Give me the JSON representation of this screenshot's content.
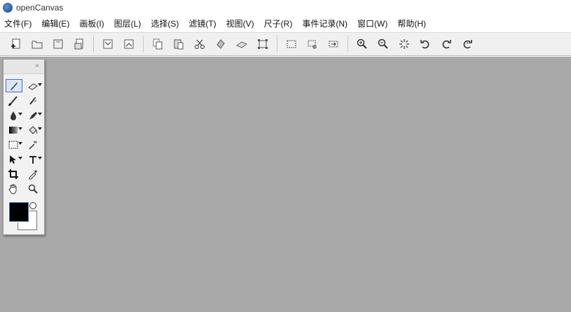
{
  "window": {
    "title": "openCanvas"
  },
  "menu": {
    "items": [
      {
        "label": "文件(F)"
      },
      {
        "label": "编辑(E)"
      },
      {
        "label": "画板(I)"
      },
      {
        "label": "图层(L)"
      },
      {
        "label": "选择(S)"
      },
      {
        "label": "滤镜(T)"
      },
      {
        "label": "视图(V)"
      },
      {
        "label": "尺子(R)"
      },
      {
        "label": "事件记录(N)"
      },
      {
        "label": "窗口(W)"
      },
      {
        "label": "帮助(H)"
      }
    ]
  },
  "toolbar": {
    "icons": [
      "new-file-icon",
      "open-icon",
      "save-icon",
      "print-icon",
      "import-icon",
      "export-icon",
      "copy-icon",
      "paste-icon",
      "cut-icon",
      "stamp-icon",
      "eraser-block-icon",
      "transform-icon",
      "select-rect-icon",
      "deselect-icon",
      "flip-icon",
      "zoom-in-icon",
      "zoom-out-icon",
      "loading-icon",
      "rotate-left-icon",
      "rotate-right-icon",
      "rotate-reset-icon"
    ]
  },
  "palette": {
    "tools": [
      "pen",
      "eraser",
      "brush",
      "airbrush",
      "water",
      "marker",
      "gradient",
      "bucket",
      "rect-select",
      "magic-wand",
      "move",
      "text",
      "crop",
      "eyedropper",
      "hand",
      "zoom"
    ],
    "foreground_color": "#000000",
    "background_color": "#ffffff"
  },
  "colors": {
    "workspace": "#a9a9a9",
    "toolbar": "#f0f0f0",
    "accent": "#3a6fc0"
  }
}
